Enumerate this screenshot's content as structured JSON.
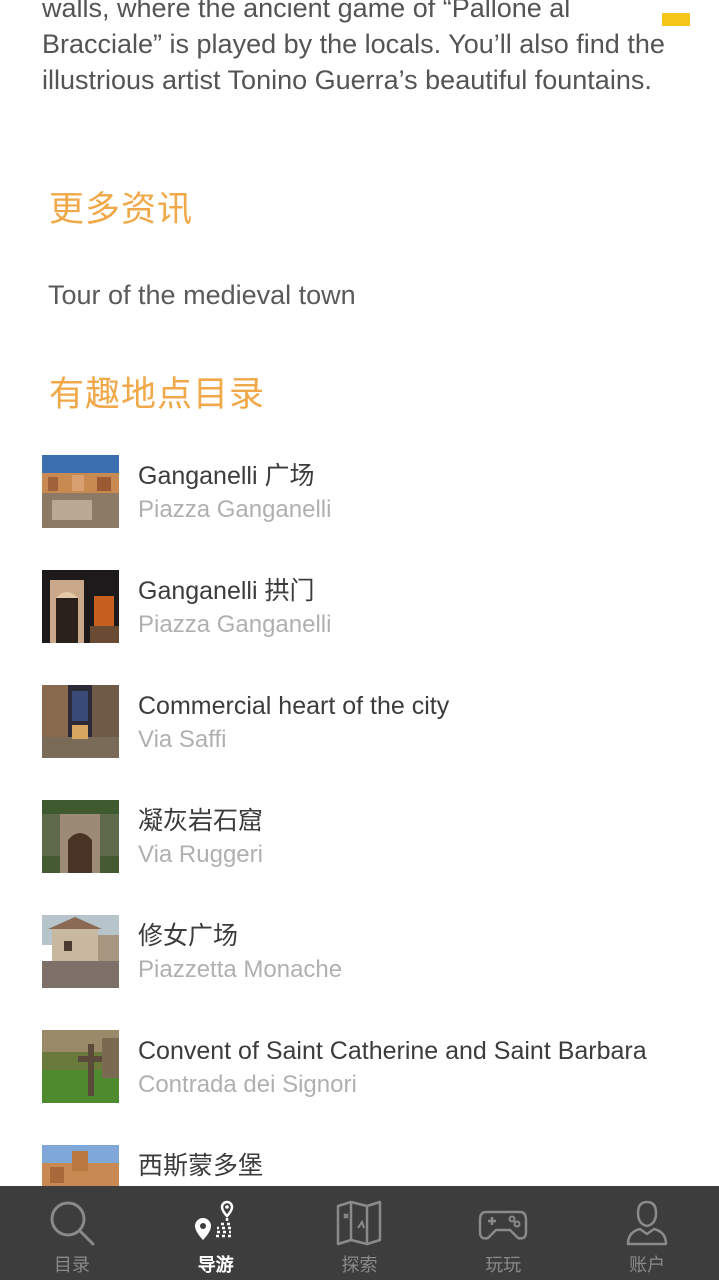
{
  "intro": {
    "text": "walls, where the ancient game of “Pallone al Bracciale” is played by the locals. You’ll also find the illustrious artist Tonino Guerra’s beautiful fountains."
  },
  "more_info": {
    "heading": "更多资讯",
    "link_label": "Tour of the medieval town"
  },
  "poi_section": {
    "heading": "有趣地点目录",
    "items": [
      {
        "title": "Ganganelli 广场",
        "subtitle": "Piazza Ganganelli"
      },
      {
        "title": "Ganganelli 拱门",
        "subtitle": "Piazza Ganganelli"
      },
      {
        "title": "Commercial heart of the city",
        "subtitle": "Via Saffi"
      },
      {
        "title": "凝灰岩石窟",
        "subtitle": "Via Ruggeri"
      },
      {
        "title": "修女广场",
        "subtitle": "Piazzetta Monache"
      },
      {
        "title": "Convent of Saint Catherine and Saint Barbara",
        "subtitle": "Contrada dei Signori"
      },
      {
        "title": "西斯蒙多堡",
        "subtitle": ""
      }
    ]
  },
  "tab_bar": {
    "tabs": [
      {
        "label": "目录",
        "icon": "search-icon",
        "active": false
      },
      {
        "label": "导游",
        "icon": "route-pin-icon",
        "active": true
      },
      {
        "label": "探索",
        "icon": "map-icon",
        "active": false
      },
      {
        "label": "玩玩",
        "icon": "gamepad-icon",
        "active": false
      },
      {
        "label": "账户",
        "icon": "user-icon",
        "active": false
      }
    ]
  },
  "colors": {
    "accent_orange": "#f0a848",
    "tab_bar_bg": "#3d3d3d",
    "status_yellow": "#f5c518"
  }
}
